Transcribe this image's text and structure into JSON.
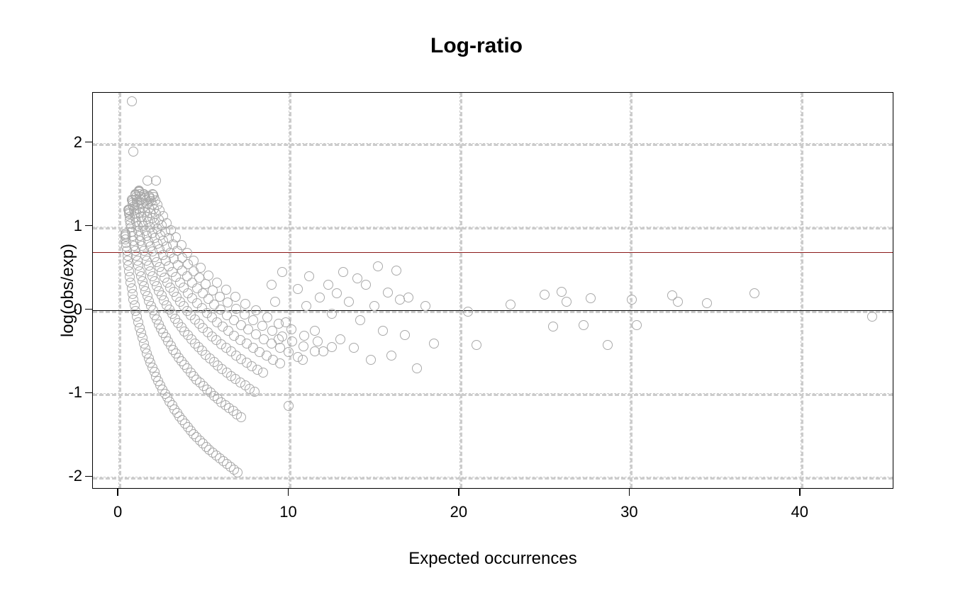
{
  "chart_data": {
    "type": "scatter",
    "title": "Log-ratio",
    "xlabel": "Expected occurrences",
    "ylabel": "log(obs/exp)",
    "xlim": [
      -1.5,
      45.5
    ],
    "ylim": [
      -2.15,
      2.6
    ],
    "x_ticks": [
      0,
      10,
      20,
      30,
      40
    ],
    "y_ticks": [
      -2,
      -1,
      0,
      1,
      2
    ],
    "grid": true,
    "reference_lines": [
      {
        "y": 0.0,
        "color": "#000000"
      },
      {
        "y": 0.69,
        "color": "#8b1a1a"
      }
    ],
    "point_color": "#a9a9a9",
    "point_style": "open-circle",
    "curves": [
      {
        "obs": 1,
        "x0": 0.4,
        "x1": 7.0,
        "n": 60
      },
      {
        "obs": 2,
        "x0": 0.6,
        "x1": 7.2,
        "n": 55
      },
      {
        "obs": 3,
        "x0": 0.8,
        "x1": 8.0,
        "n": 50
      },
      {
        "obs": 4,
        "x0": 1.0,
        "x1": 8.5,
        "n": 45
      },
      {
        "obs": 5,
        "x0": 1.2,
        "x1": 9.5,
        "n": 40
      },
      {
        "obs": 6,
        "x0": 1.5,
        "x1": 10.5,
        "n": 35
      },
      {
        "obs": 7,
        "x0": 1.8,
        "x1": 11.5,
        "n": 30
      },
      {
        "obs": 8,
        "x0": 2.0,
        "x1": 12.5,
        "n": 26
      }
    ],
    "scatter_extra": [
      [
        9.0,
        0.3
      ],
      [
        9.2,
        0.1
      ],
      [
        9.4,
        -0.35
      ],
      [
        9.6,
        0.45
      ],
      [
        9.8,
        -0.15
      ],
      [
        10.0,
        -1.15
      ],
      [
        10.5,
        0.25
      ],
      [
        10.8,
        -0.6
      ],
      [
        11.0,
        0.05
      ],
      [
        11.2,
        0.4
      ],
      [
        11.5,
        -0.25
      ],
      [
        11.8,
        0.15
      ],
      [
        12.0,
        -0.5
      ],
      [
        12.3,
        0.3
      ],
      [
        12.5,
        -0.05
      ],
      [
        12.8,
        0.2
      ],
      [
        13.0,
        -0.35
      ],
      [
        13.2,
        0.45
      ],
      [
        13.5,
        0.1
      ],
      [
        13.8,
        -0.45
      ],
      [
        14.0,
        0.38
      ],
      [
        14.2,
        -0.12
      ],
      [
        14.5,
        0.3
      ],
      [
        14.8,
        -0.6
      ],
      [
        15.0,
        0.05
      ],
      [
        15.2,
        0.52
      ],
      [
        15.5,
        -0.25
      ],
      [
        15.8,
        0.21
      ],
      [
        16.0,
        -0.55
      ],
      [
        16.3,
        0.47
      ],
      [
        16.5,
        0.12
      ],
      [
        16.8,
        -0.3
      ],
      [
        17.0,
        0.15
      ],
      [
        17.5,
        -0.7
      ],
      [
        18.0,
        0.05
      ],
      [
        18.5,
        -0.4
      ],
      [
        20.5,
        -0.02
      ],
      [
        21.0,
        -0.42
      ],
      [
        23.0,
        0.06
      ],
      [
        25.0,
        0.18
      ],
      [
        25.5,
        -0.2
      ],
      [
        26.0,
        0.22
      ],
      [
        26.3,
        0.1
      ],
      [
        27.3,
        -0.18
      ],
      [
        27.7,
        0.14
      ],
      [
        28.7,
        -0.42
      ],
      [
        30.1,
        0.12
      ],
      [
        30.4,
        -0.18
      ],
      [
        32.5,
        0.17
      ],
      [
        32.8,
        0.1
      ],
      [
        34.5,
        0.08
      ],
      [
        37.3,
        0.2
      ],
      [
        44.2,
        -0.08
      ],
      [
        0.8,
        2.5
      ],
      [
        0.85,
        1.9
      ],
      [
        1.7,
        1.55
      ],
      [
        2.2,
        1.55
      ]
    ]
  }
}
